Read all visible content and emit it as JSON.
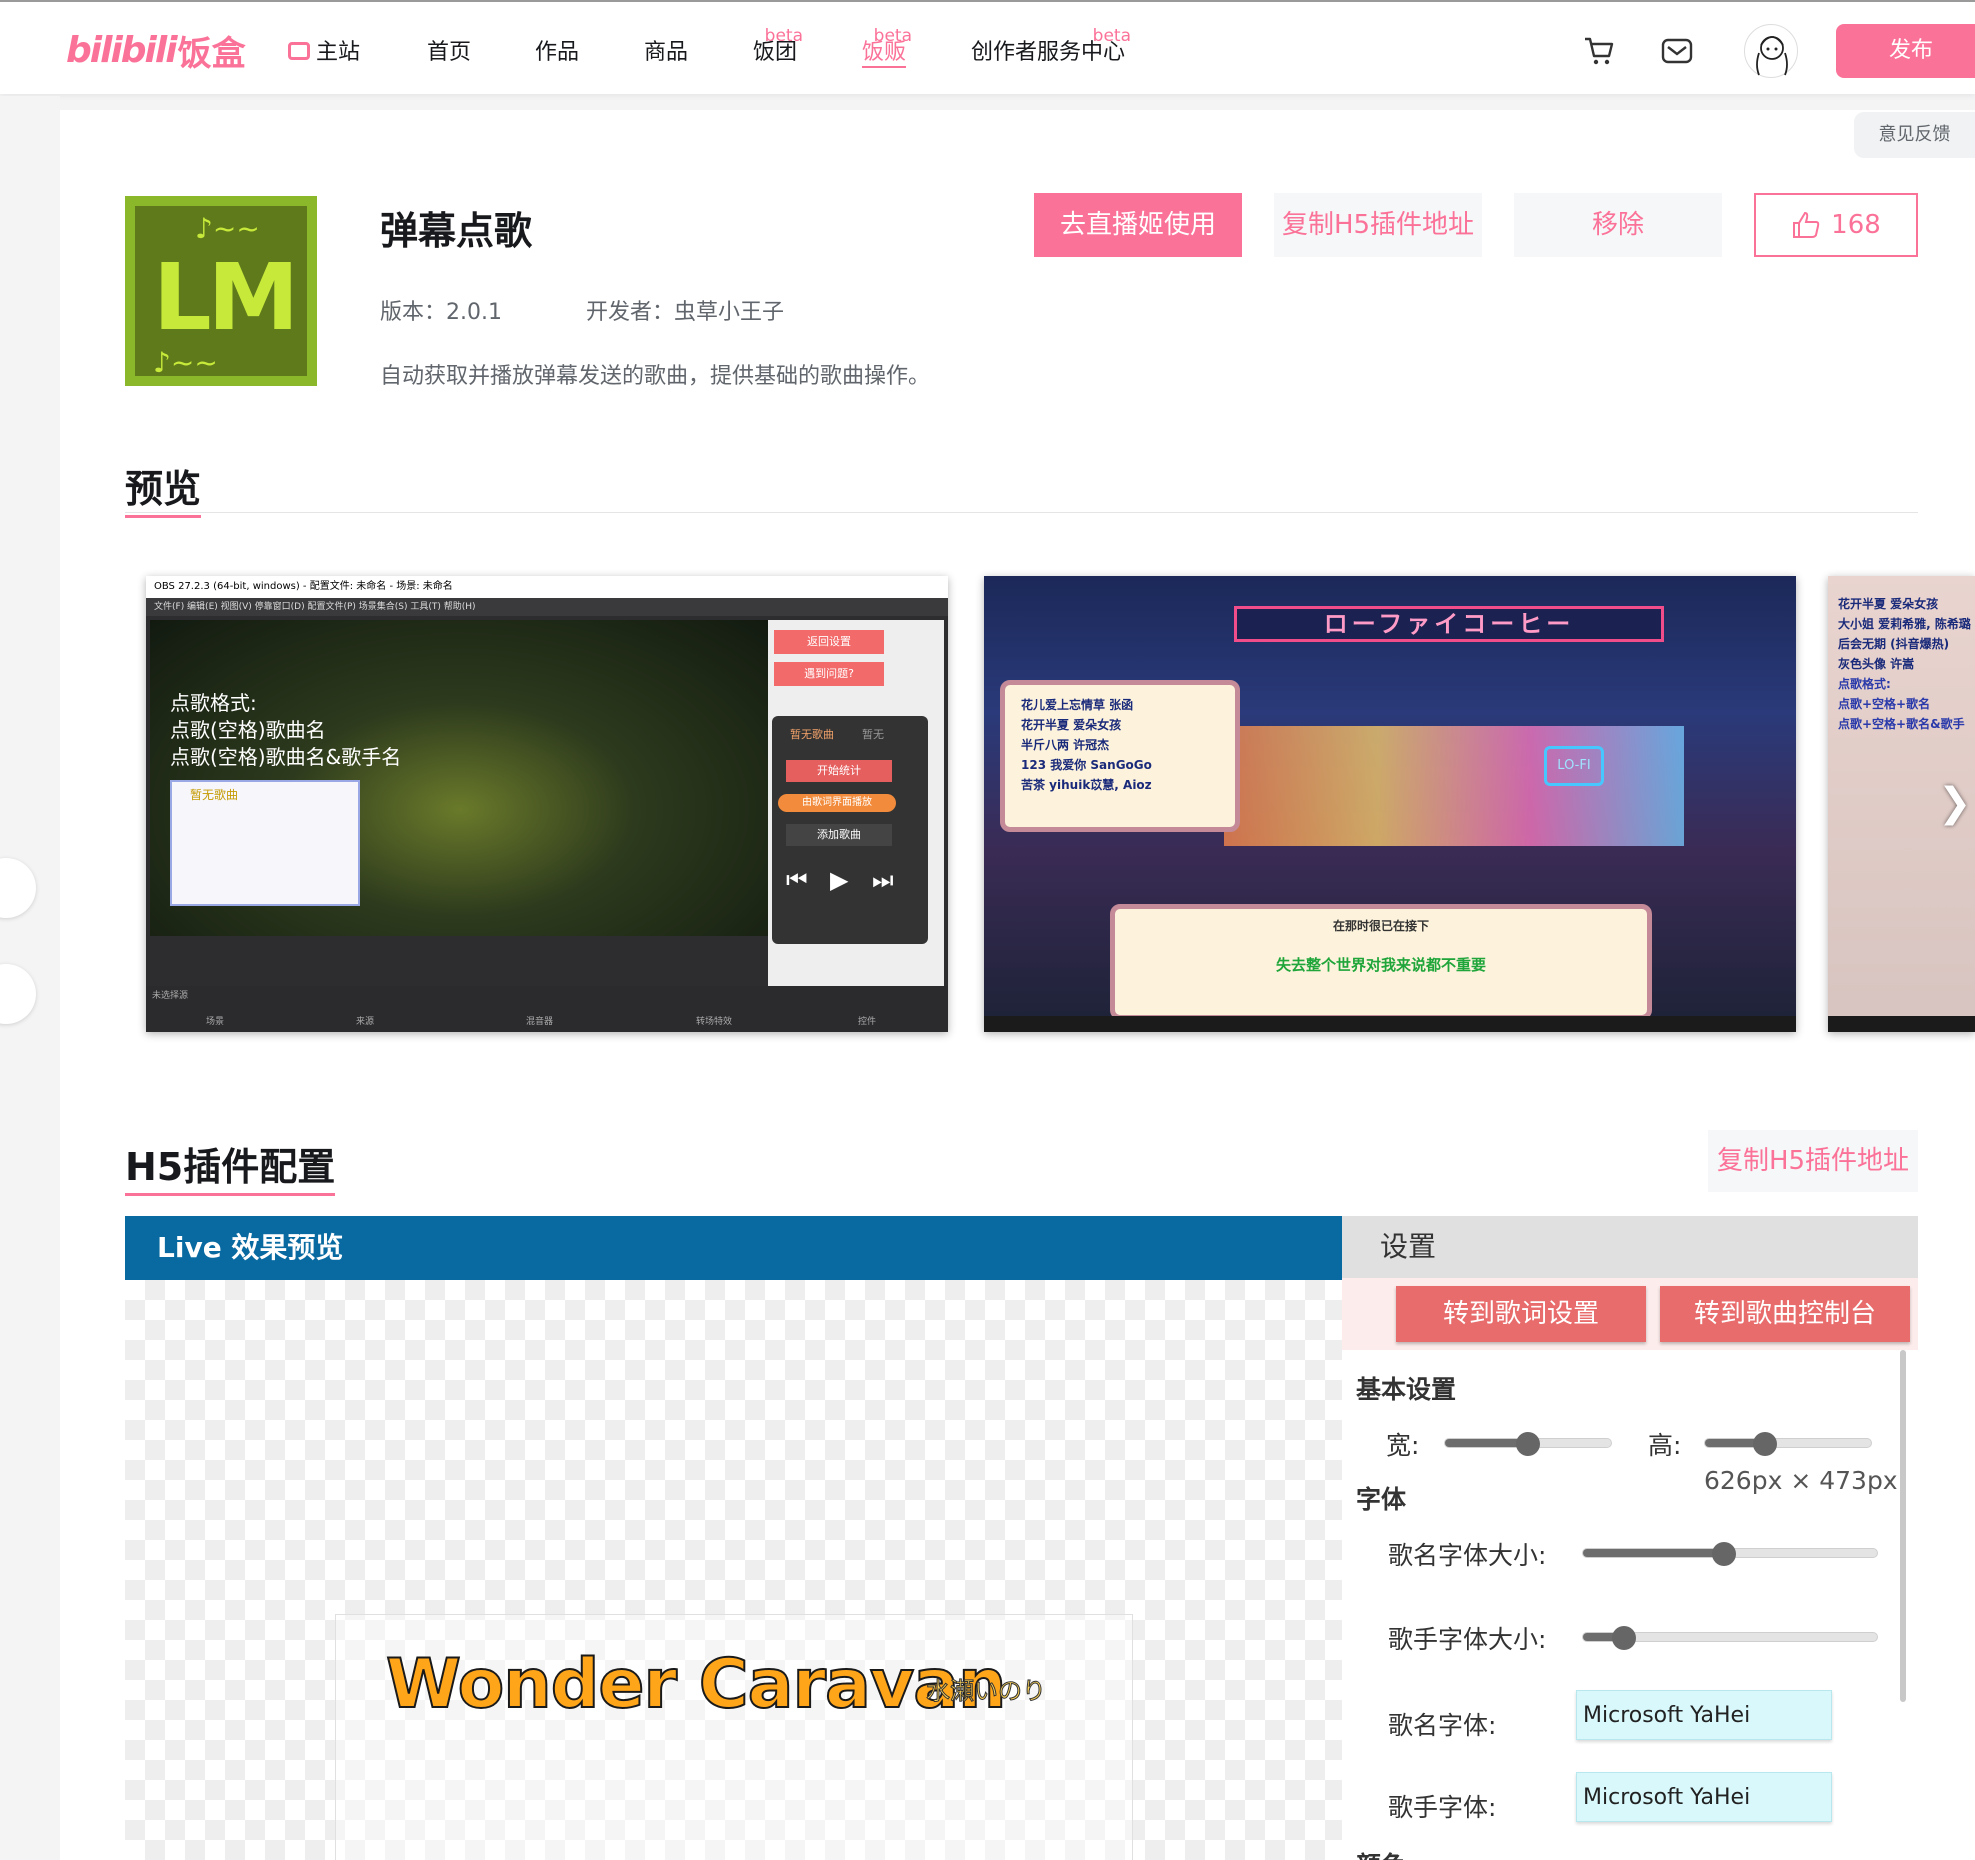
{
  "nav": {
    "logo_bili": "bilibili",
    "logo_fanhe": "饭盒",
    "items": [
      {
        "label": "主站",
        "beta": ""
      },
      {
        "label": "首页",
        "beta": ""
      },
      {
        "label": "作品",
        "beta": ""
      },
      {
        "label": "商品",
        "beta": ""
      },
      {
        "label": "饭团",
        "beta": "beta"
      },
      {
        "label": "饭贩",
        "beta": "beta"
      },
      {
        "label": "创作者服务中心",
        "beta": "beta"
      }
    ],
    "icons": [
      "cart-icon",
      "mail-icon"
    ],
    "publish_label": "发布",
    "accent_color": "#fb7299"
  },
  "feedback_label": "意见反馈",
  "plugin": {
    "title": "弹幕点歌",
    "version_label": "版本：2.0.1",
    "developer_label": "开发者：虫草小王子",
    "description": "自动获取并播放弹幕发送的歌曲，提供基础的歌曲操作。",
    "icon_text": "LM",
    "icon_notes_top": "♪~~",
    "icon_notes_bottom": "♪~~",
    "buttons": {
      "use": "去直播姬使用",
      "copy_h5": "复制H5插件地址",
      "remove": "移除",
      "likes": "168"
    }
  },
  "preview": {
    "title": "预览",
    "shot1": {
      "window_title": "OBS 27.2.3 (64-bit, windows) - 配置文件: 未命名 - 场景: 未命名",
      "menu": "文件(F)   编辑(E)   视图(V)   停靠窗口(D)   配置文件(P)   场景集合(S)   工具(T)   帮助(H)",
      "overlay_text": [
        "点歌格式:",
        "点歌(空格)歌曲名",
        "点歌(空格)歌曲名&歌手名"
      ],
      "popup_text": "暂无歌曲",
      "panel_buttons": [
        "返回设置",
        "遇到问题?"
      ],
      "panel_dark": {
        "now": "暂无歌曲",
        "now_sub": "暂无",
        "start": "开始统计",
        "toggle": "由歌词界面播放",
        "add": "添加歌曲"
      },
      "bottom_tabs": [
        "场景",
        "来源",
        "混音器",
        "转场特效",
        "控件"
      ],
      "no_source": "未选择源"
    },
    "shot2": {
      "sign": "ローファイコーヒー",
      "list": [
        "花儿爱上忘情草 张函",
        "花开半夏 爱朵女孩",
        "半斤八两 许冠杰",
        "123 我爱你 SanGoGo",
        "苦茶 yihuik苡慧, Aioz"
      ],
      "lyric_top": "在那时很已在接下",
      "lyric_main": "失去整个世界对我来说都不重要",
      "cup_label": "LO-FI"
    },
    "shot3": {
      "list": [
        "花开半夏 爱朵女孩",
        "大小姐 爱莉希雅, 陈希璐",
        "后会无期 (抖音爆热)",
        "灰色头像 许嵩",
        "点歌格式:",
        "点歌+空格+歌名",
        "点歌+空格+歌名&歌手"
      ]
    },
    "next_arrow": "❯"
  },
  "config": {
    "title": "H5插件配置",
    "copy_label": "复制H5插件地址",
    "live_label": "Live 效果预览",
    "song_name": "Wonder Caravan",
    "singer_name": "水瀬いのり",
    "settings": {
      "title": "设置",
      "tab_lyrics": "转到歌词设置",
      "tab_console": "转到歌曲控制台",
      "basic_group": "基本设置",
      "width_label": "宽:",
      "height_label": "高:",
      "width_level": 0.5,
      "height_level": 0.36,
      "size_text": "626px × 473px",
      "font_group": "字体",
      "song_font_size_label": "歌名字体大小:",
      "singer_font_size_label": "歌手字体大小:",
      "song_font_size_level": 0.48,
      "singer_font_size_level": 0.14,
      "song_font_label": "歌名字体:",
      "singer_font_label": "歌手字体:",
      "song_font_value": "Microsoft YaHei",
      "singer_font_value": "Microsoft YaHei",
      "next_group": "颜色"
    }
  }
}
